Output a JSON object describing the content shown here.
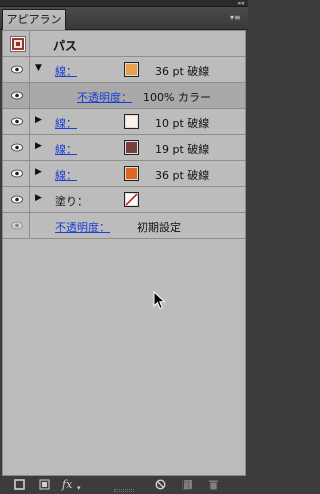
{
  "panel": {
    "tab_label": "アピアランス",
    "object_title": "パス"
  },
  "rows": [
    {
      "kind": "stroke",
      "label": "線：",
      "value": "36 pt 破線",
      "swatch": "#e8a050",
      "expanded": true
    },
    {
      "kind": "opacity",
      "label": "不透明度：",
      "value": "100% カラー"
    },
    {
      "kind": "stroke",
      "label": "線：",
      "value": "10 pt 破線",
      "swatch": "#fbf3e6"
    },
    {
      "kind": "stroke",
      "label": "線：",
      "value": "19 pt 破線",
      "swatch": "#7a3f3b"
    },
    {
      "kind": "stroke",
      "label": "線：",
      "value": "36 pt 破線",
      "swatch": "#e06624"
    },
    {
      "kind": "fill",
      "label": "塗り："
    },
    {
      "kind": "opacity",
      "label": "不透明度：",
      "value": "初期設定"
    }
  ],
  "colors": {
    "panel_bg": "#bcbcbc",
    "highlight_row": "#a9a9a9",
    "link_blue": "#1b3fd6",
    "chrome": "#3c3c3c"
  },
  "footer": {
    "icons": [
      "add-stroke-icon",
      "add-fill-icon",
      "fx-icon",
      "clear-appearance-icon",
      "duplicate-item-icon",
      "delete-item-icon"
    ],
    "fx_label": "fx"
  }
}
